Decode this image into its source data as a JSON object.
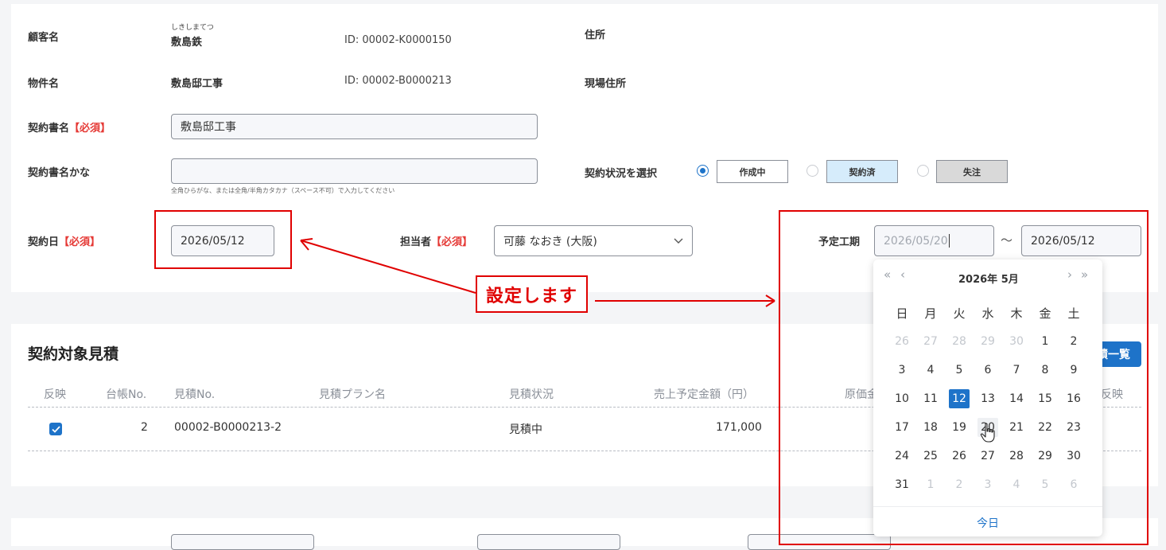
{
  "customer": {
    "label": "顧客名",
    "furigana": "しきしまてつ",
    "name": "敷島鉄",
    "id": "ID: 00002-K0000150",
    "address_label": "住所"
  },
  "property": {
    "label": "物件名",
    "name": "敷島邸工事",
    "id": "ID: 00002-B0000213",
    "site_address_label": "現場住所"
  },
  "contract": {
    "name_label": "契約書名",
    "required": "【必須】",
    "name_value": "敷島邸工事",
    "kana_label": "契約書名かな",
    "kana_value": "",
    "kana_hint": "全角ひらがな、または全角/半角カタカナ（スペース不可）で入力してください",
    "status_label": "契約状況を選択",
    "statuses": [
      "作成中",
      "契約済",
      "失注"
    ],
    "date_label": "契約日",
    "date_value": "2026/05/12",
    "person_label": "担当者",
    "person_value": "可藤 なおき (大阪)",
    "period_label": "予定工期",
    "period_start": "2026/05/20",
    "period_tilde": "～",
    "period_end": "2026/05/12"
  },
  "annotation": {
    "callout": "設定します"
  },
  "calendar": {
    "year_month": "2026年  5月",
    "nav_prev_year": "«",
    "nav_prev_month": "‹",
    "nav_next_month": "›",
    "nav_next_year": "»",
    "weekdays": [
      "日",
      "月",
      "火",
      "水",
      "木",
      "金",
      "土"
    ],
    "weeks": [
      [
        "26",
        "27",
        "28",
        "29",
        "30",
        "1",
        "2"
      ],
      [
        "3",
        "4",
        "5",
        "6",
        "7",
        "8",
        "9"
      ],
      [
        "10",
        "11",
        "12",
        "13",
        "14",
        "15",
        "16"
      ],
      [
        "17",
        "18",
        "19",
        "20",
        "21",
        "22",
        "23"
      ],
      [
        "24",
        "25",
        "26",
        "27",
        "28",
        "29",
        "30"
      ],
      [
        "31",
        "1",
        "2",
        "3",
        "4",
        "5",
        "6"
      ]
    ],
    "selected": "12",
    "hovered": "20",
    "today_label": "今日"
  },
  "estimate": {
    "title": "契約対象見積",
    "list_button": "積一覧",
    "columns": [
      "反映",
      "台帳No.",
      "見積No.",
      "見積プラン名",
      "見積状況",
      "売上予定金額（円）",
      "原価金",
      "反映"
    ],
    "rows": [
      {
        "checked": true,
        "ledger_no": "2",
        "estimate_no": "00002-B0000213-2",
        "plan": "",
        "status": "見積中",
        "amount": "171,000"
      }
    ]
  },
  "colors": {
    "accent": "#1e73c9",
    "required": "#e53935",
    "annotation": "#e00000",
    "contracted_bg": "#d6ecfb",
    "lost_bg": "#d9d9d9"
  }
}
